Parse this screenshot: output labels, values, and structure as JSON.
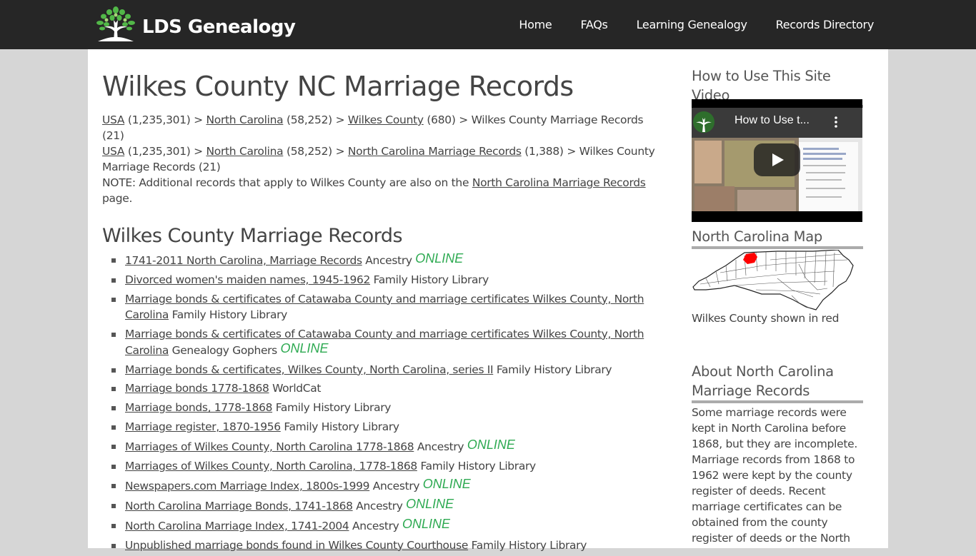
{
  "header": {
    "logo_text": "LDS Genealogy",
    "nav": [
      {
        "label": "Home"
      },
      {
        "label": "FAQs"
      },
      {
        "label": "Learning Genealogy"
      },
      {
        "label": "Records Directory"
      }
    ]
  },
  "main": {
    "title": "Wilkes County NC Marriage Records",
    "breadcrumbs": [
      {
        "parts": [
          {
            "link": "USA",
            "count": "(1,235,301)"
          },
          {
            "link": "North Carolina",
            "count": "(58,252)"
          },
          {
            "link": "Wilkes County",
            "count": "(680)"
          }
        ],
        "current": "Wilkes County Marriage Records (21)"
      },
      {
        "parts": [
          {
            "link": "USA",
            "count": "(1,235,301)"
          },
          {
            "link": "North Carolina",
            "count": "(58,252)"
          },
          {
            "link": "North Carolina Marriage Records",
            "count": "(1,388)"
          }
        ],
        "current": "Wilkes County Marriage Records (21)"
      }
    ],
    "separator": ">",
    "note": {
      "prefix": "NOTE: Additional records that apply to Wilkes County are also on the",
      "link": "North Carolina Marriage Records",
      "suffix": "page."
    },
    "section_title": "Wilkes County Marriage Records",
    "online_label": "ONLINE",
    "records": [
      {
        "title": "1741-2011 North Carolina, Marriage Records",
        "source": "Ancestry",
        "online": true
      },
      {
        "title": "Divorced women's maiden names, 1945-1962",
        "source": "Family History Library",
        "online": false
      },
      {
        "title": "Marriage bonds & certificates of Catawaba County and marriage certificates Wilkes County, North Carolina",
        "source": "Family History Library",
        "online": false
      },
      {
        "title": "Marriage bonds & certificates of Catawaba County and marriage certificates Wilkes County, North Carolina",
        "source": "Genealogy Gophers",
        "online": true
      },
      {
        "title": "Marriage bonds & certificates, Wilkes County, North Carolina, series II",
        "source": "Family History Library",
        "online": false
      },
      {
        "title": "Marriage bonds 1778-1868",
        "source": "WorldCat",
        "online": false
      },
      {
        "title": "Marriage bonds, 1778-1868",
        "source": "Family History Library",
        "online": false
      },
      {
        "title": "Marriage register, 1870-1956",
        "source": "Family History Library",
        "online": false
      },
      {
        "title": "Marriages of Wilkes County, North Carolina 1778-1868",
        "source": "Ancestry",
        "online": true
      },
      {
        "title": "Marriages of Wilkes County, North Carolina, 1778-1868",
        "source": "Family History Library",
        "online": false
      },
      {
        "title": "Newspapers.com Marriage Index, 1800s-1999",
        "source": "Ancestry",
        "online": true
      },
      {
        "title": "North Carolina Marriage Bonds, 1741-1868",
        "source": "Ancestry",
        "online": true
      },
      {
        "title": "North Carolina Marriage Index, 1741-2004",
        "source": "Ancestry",
        "online": true
      },
      {
        "title": "Unpublished marriage bonds found in Wilkes County Courthouse",
        "source": "Family History Library",
        "online": false
      }
    ]
  },
  "sidebar": {
    "video_title": "How to Use This Site Video",
    "video_overlay_title": "How to Use t...",
    "map_title": "North Carolina Map",
    "map_caption": "Wilkes County shown in red",
    "about_title": "About North Carolina Marriage Records",
    "about_text": "Some marriage records were kept in North Carolina before 1868, but they are incomplete. Marriage records from 1868 to 1962 were kept by the county register of deeds. Recent marriage certificates can be obtained from the county register of deeds or the North"
  },
  "colors": {
    "header_bg": "#262626",
    "page_bg": "#d6d6d6",
    "text": "#444444",
    "online_green": "#2eaa52",
    "highlight_red": "#ff0000",
    "rule_gray": "#ababab"
  }
}
